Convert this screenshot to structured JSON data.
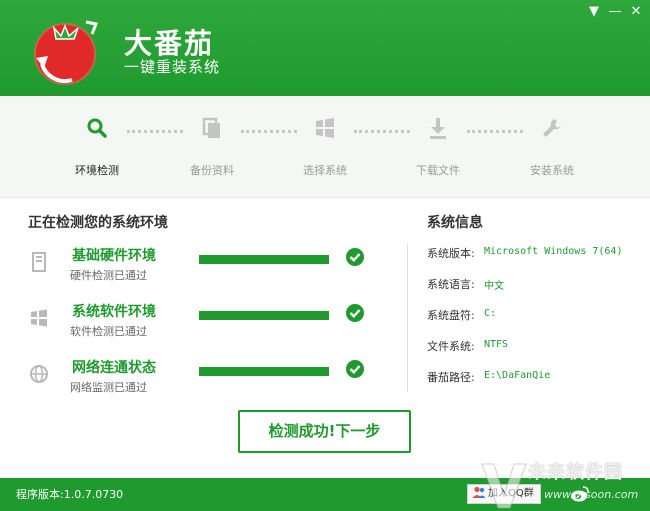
{
  "app": {
    "title": "大番茄",
    "subtitle": "一键重装系统",
    "icons": {
      "logo": "tomato-logo",
      "menu": "menu-icon",
      "minimize": "minimize-icon",
      "close": "close-icon"
    },
    "window_buttons": {
      "menu": "▼",
      "minimize": "—",
      "close": "✕"
    }
  },
  "steps": [
    {
      "label": "环境检测",
      "icon": "search-icon",
      "active": true
    },
    {
      "label": "备份资料",
      "icon": "copy-icon",
      "active": false
    },
    {
      "label": "选择系统",
      "icon": "windows-icon",
      "active": false
    },
    {
      "label": "下载文件",
      "icon": "download-icon",
      "active": false
    },
    {
      "label": "安装系统",
      "icon": "wrench-icon",
      "active": false
    }
  ],
  "detect": {
    "title": "正在检测您的系统环境",
    "items": [
      {
        "title": "基础硬件环境",
        "sub": "硬件检测已通过",
        "icon": "hardware-icon",
        "progress": 1.0,
        "status": "passed"
      },
      {
        "title": "系统软件环境",
        "sub": "软件检测已通过",
        "icon": "windows-icon",
        "progress": 1.0,
        "status": "passed"
      },
      {
        "title": "网络连通状态",
        "sub": "网络监测已通过",
        "icon": "globe-icon",
        "progress": 1.0,
        "status": "passed"
      }
    ]
  },
  "sysinfo": {
    "title": "系统信息",
    "rows": [
      {
        "label": "系统版本:",
        "value": "Microsoft Windows 7(64)"
      },
      {
        "label": "系统语言:",
        "value": "中文"
      },
      {
        "label": "系统盘符:",
        "value": "C:"
      },
      {
        "label": "文件系统:",
        "value": "NTFS"
      },
      {
        "label": "番茄路径:",
        "value": "E:\\DaFanQie"
      }
    ]
  },
  "next_button": "检测成功!下一步",
  "footer": {
    "version": "程序版本:1.0.7.0730",
    "qq_button": "加入QQ群",
    "qq_icon": "qq-group-icon",
    "weibo_icon": "weibo-icon"
  },
  "watermark": {
    "text": "未来软件园",
    "url": "www.orsoon.com"
  },
  "colors": {
    "primary": "#1f9a2e",
    "header_green": "#2ea83b",
    "progress_track": "#e0e0e0",
    "tomato_red": "#e02a2a"
  }
}
